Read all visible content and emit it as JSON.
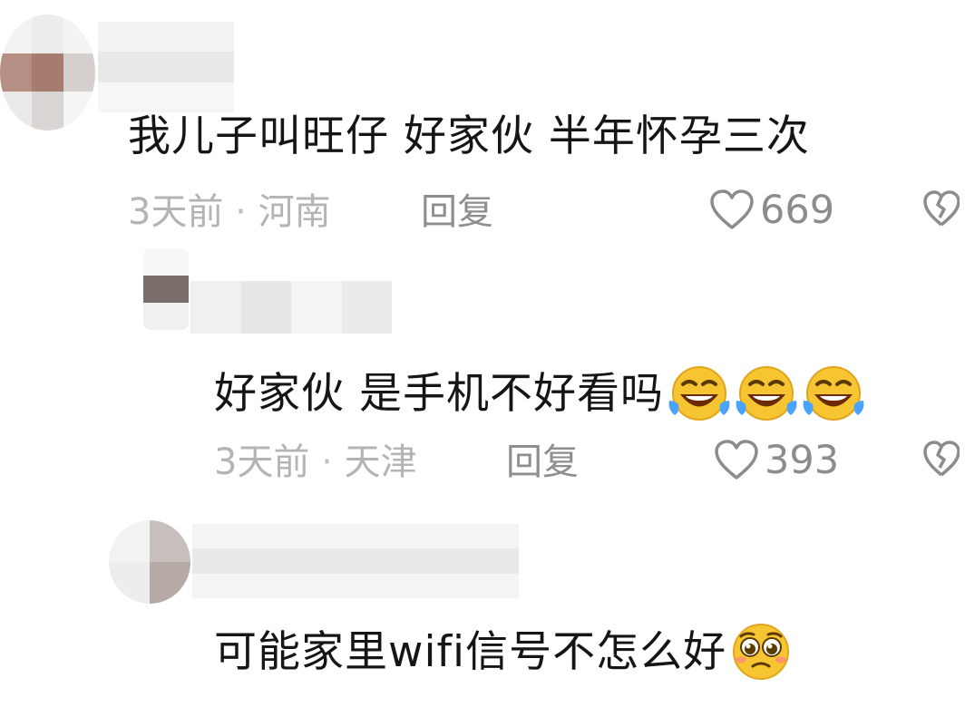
{
  "comments": [
    {
      "text": "我儿子叫旺仔 好家伙 半年怀孕三次",
      "time": "3天前",
      "sep": "·",
      "location": "河南",
      "reply_label": "回复",
      "likes": "669"
    },
    {
      "text": "好家伙 是手机不好看吗",
      "emoji": [
        "laugh-cry-emoji",
        "laugh-cry-emoji",
        "laugh-cry-emoji"
      ],
      "time": "3天前",
      "sep": "·",
      "location": "天津",
      "reply_label": "回复",
      "likes": "393"
    },
    {
      "text": "可能家里wifi信号不怎么好",
      "emoji": [
        "pleading-face-emoji"
      ]
    }
  ],
  "colors": {
    "comment_text": "#151515",
    "meta_text": "#b4b4b4",
    "icon_gray": "#8c8c8c",
    "emoji_yellow": "#f7c531",
    "tear_blue": "#4aa3ff"
  }
}
